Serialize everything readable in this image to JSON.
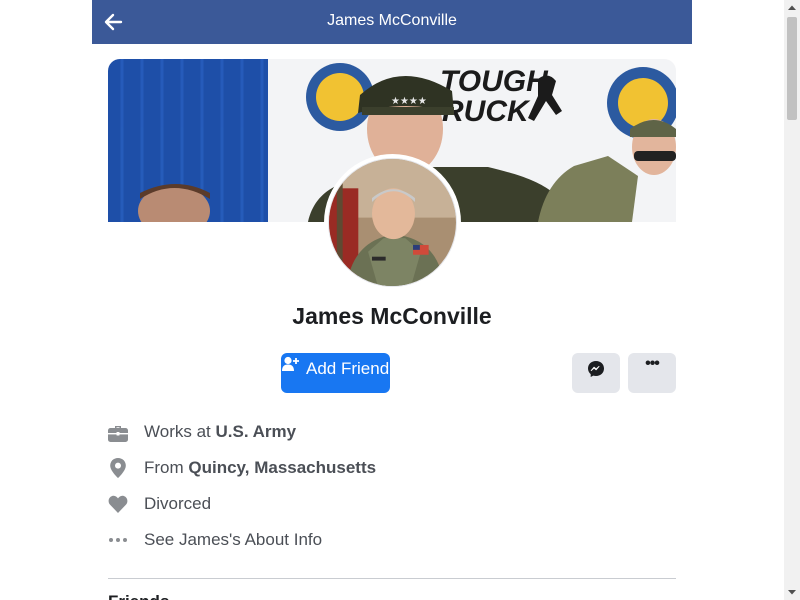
{
  "header": {
    "title": "James McConville"
  },
  "profile": {
    "name": "James McConville",
    "add_friend_label": "Add Friend"
  },
  "cover": {
    "banner_text": "TOUGH RUCK"
  },
  "details": {
    "work_prefix": "Works at ",
    "work_place": "U.S. Army",
    "from_prefix": "From ",
    "from_place": "Quincy, Massachusetts",
    "relationship": "Divorced",
    "about_link": "See James's About Info"
  },
  "next_section": {
    "title": "Friends"
  },
  "colors": {
    "header_bg": "#3b5998",
    "primary_button": "#1877f2",
    "secondary_button": "#e4e6eb",
    "icon_gray": "#8a8d91"
  },
  "icons": {
    "back": "arrow-left-icon",
    "add_friend": "person-plus-icon",
    "messenger": "messenger-icon",
    "more": "more-horizontal-icon",
    "work": "briefcase-icon",
    "from": "location-pin-icon",
    "relationship": "heart-icon",
    "about": "ellipsis-icon"
  }
}
